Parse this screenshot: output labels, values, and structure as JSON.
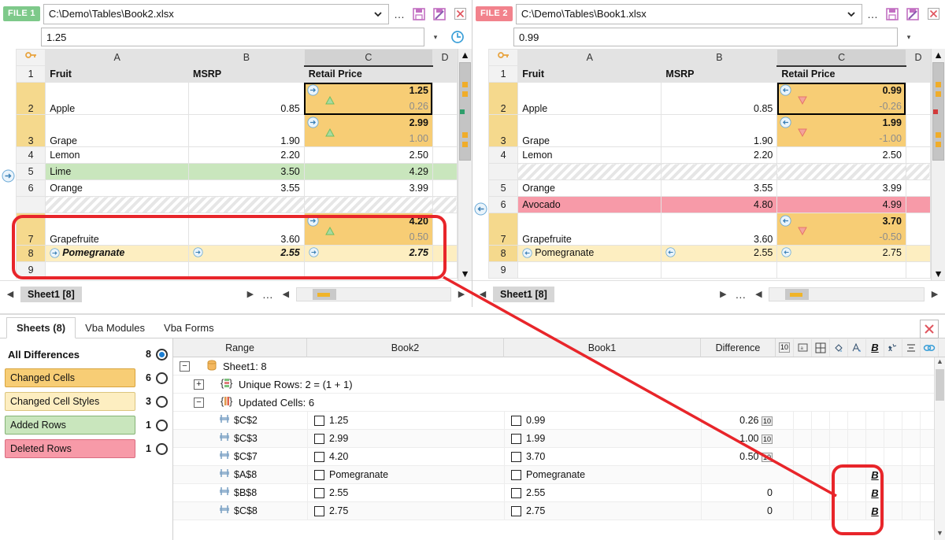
{
  "file1": {
    "badge": "FILE 1",
    "path": "C:\\Demo\\Tables\\Book2.xlsx",
    "formula": "1.25",
    "sheet_tab": "Sheet1 [8]",
    "columns": [
      "A",
      "B",
      "C",
      "D"
    ],
    "header_row": [
      "Fruit",
      "MSRP",
      "Retail Price"
    ],
    "rows": [
      {
        "n": "1",
        "a": "Fruit",
        "b": "MSRP",
        "c": "Retail Price",
        "kind": "header"
      },
      {
        "n": "2",
        "a": "Apple",
        "b": "0.85",
        "c_new": "1.25",
        "c_old": "0.26",
        "kind": "changed",
        "framed": true,
        "dir": "right",
        "trend": "up"
      },
      {
        "n": "3",
        "a": "Grape",
        "b": "1.90",
        "c_new": "2.99",
        "c_old": "1.00",
        "kind": "changed",
        "dir": "right",
        "trend": "up"
      },
      {
        "n": "4",
        "a": "Lemon",
        "b": "2.20",
        "c": "2.50",
        "kind": "normal"
      },
      {
        "n": "5",
        "a": "Lime",
        "b": "3.50",
        "c": "4.29",
        "kind": "added",
        "dir": "right"
      },
      {
        "n": "6",
        "a": "Orange",
        "b": "3.55",
        "c": "3.99",
        "kind": "normal"
      },
      {
        "n": "",
        "a": "",
        "b": "",
        "c": "",
        "kind": "hatch"
      },
      {
        "n": "7",
        "a": "Grapefruite",
        "b": "3.60",
        "c_new": "4.20",
        "c_old": "0.50",
        "kind": "changed",
        "dir": "right",
        "trend": "up"
      },
      {
        "n": "8",
        "a": "Pomegranate",
        "b": "2.55",
        "c": "2.75",
        "kind": "style",
        "dir": "right"
      },
      {
        "n": "9",
        "a": "",
        "b": "",
        "c": "",
        "kind": "normal"
      }
    ]
  },
  "file2": {
    "badge": "FILE 2",
    "path": "C:\\Demo\\Tables\\Book1.xlsx",
    "formula": "0.99",
    "sheet_tab": "Sheet1 [8]",
    "columns": [
      "A",
      "B",
      "C",
      "D"
    ],
    "header_row": [
      "Fruit",
      "MSRP",
      "Retail Price"
    ],
    "rows": [
      {
        "n": "1",
        "a": "Fruit",
        "b": "MSRP",
        "c": "Retail Price",
        "kind": "header"
      },
      {
        "n": "2",
        "a": "Apple",
        "b": "0.85",
        "c_new": "0.99",
        "c_old": "-0.26",
        "kind": "changed",
        "framed": true,
        "dir": "left",
        "trend": "down"
      },
      {
        "n": "3",
        "a": "Grape",
        "b": "1.90",
        "c_new": "1.99",
        "c_old": "-1.00",
        "kind": "changed",
        "dir": "left",
        "trend": "down"
      },
      {
        "n": "4",
        "a": "Lemon",
        "b": "2.20",
        "c": "2.50",
        "kind": "normal"
      },
      {
        "n": "",
        "a": "",
        "b": "",
        "c": "",
        "kind": "hatch"
      },
      {
        "n": "5",
        "a": "Orange",
        "b": "3.55",
        "c": "3.99",
        "kind": "normal"
      },
      {
        "n": "6",
        "a": "Avocado",
        "b": "4.80",
        "c": "4.99",
        "kind": "deleted",
        "dir": "left"
      },
      {
        "n": "7",
        "a": "Grapefruite",
        "b": "3.60",
        "c_new": "3.70",
        "c_old": "-0.50",
        "kind": "changed",
        "dir": "left",
        "trend": "down"
      },
      {
        "n": "8",
        "a": "Pomegranate",
        "b": "2.55",
        "c": "2.75",
        "kind": "style",
        "dir": "left"
      },
      {
        "n": "9",
        "a": "",
        "b": "",
        "c": "",
        "kind": "normal"
      }
    ]
  },
  "header_icons": {
    "more": "…",
    "save": "save-icon",
    "save_as": "save-as-icon",
    "close": "close-icon",
    "refresh": "refresh-icon",
    "dropdown": "chevron-down-icon"
  },
  "bottom": {
    "tabs": [
      {
        "label": "Sheets (8)",
        "active": true
      },
      {
        "label": "Vba Modules",
        "active": false
      },
      {
        "label": "Vba Forms",
        "active": false
      }
    ],
    "close_label": "✕",
    "filters": [
      {
        "label": "All Differences",
        "count": "8",
        "selected": true,
        "color": "#ffffff"
      },
      {
        "label": "Changed Cells",
        "count": "6",
        "selected": false,
        "color": "#f7cd75"
      },
      {
        "label": "Changed Cell Styles",
        "count": "3",
        "selected": false,
        "color": "#fdeec1"
      },
      {
        "label": "Added Rows",
        "count": "1",
        "selected": false,
        "color": "#c9e6bd"
      },
      {
        "label": "Deleted Rows",
        "count": "1",
        "selected": false,
        "color": "#f79aa8"
      }
    ],
    "columns": {
      "range": "Range",
      "book2": "Book2",
      "book1": "Book1",
      "difference": "Difference"
    },
    "toolbar": [
      {
        "name": "number-format-icon",
        "glyph": "10"
      },
      {
        "name": "text-format-icon",
        "glyph": "▭"
      },
      {
        "name": "borders-icon",
        "glyph": "⊞"
      },
      {
        "name": "fill-color-icon",
        "glyph": "△"
      },
      {
        "name": "font-color-icon",
        "glyph": "A"
      },
      {
        "name": "bold-icon",
        "glyph": "B"
      },
      {
        "name": "effects-icon",
        "glyph": "⚙"
      },
      {
        "name": "alignment-icon",
        "glyph": "≡"
      },
      {
        "name": "link-icon",
        "glyph": "∞"
      }
    ],
    "tree": [
      {
        "type": "node",
        "level": 0,
        "expander": "−",
        "icon": "sheet-icon",
        "label": "Sheet1: 8"
      },
      {
        "type": "node",
        "level": 1,
        "expander": "+",
        "icon": "unique-rows-icon",
        "label": "Unique Rows: 2 = (1 + 1)"
      },
      {
        "type": "node",
        "level": 1,
        "expander": "−",
        "icon": "updated-cells-icon",
        "label": "Updated Cells: 6"
      },
      {
        "type": "row",
        "range": "$C$2",
        "book2": "1.25",
        "book1": "0.99",
        "difference": "0.26",
        "diff_badge": "10",
        "bold": ""
      },
      {
        "type": "row",
        "range": "$C$3",
        "book2": "2.99",
        "book1": "1.99",
        "difference": "1.00",
        "diff_badge": "10",
        "bold": ""
      },
      {
        "type": "row",
        "range": "$C$7",
        "book2": "4.20",
        "book1": "3.70",
        "difference": "0.50",
        "diff_badge": "10",
        "bold": ""
      },
      {
        "type": "row",
        "range": "$A$8",
        "book2": "Pomegranate",
        "book1": "Pomegranate",
        "difference": "",
        "diff_badge": "",
        "bold": "B"
      },
      {
        "type": "row",
        "range": "$B$8",
        "book2": "2.55",
        "book1": "2.55",
        "difference": "0",
        "diff_badge": "",
        "bold": "B"
      },
      {
        "type": "row",
        "range": "$C$8",
        "book2": "2.75",
        "book1": "2.75",
        "difference": "0",
        "diff_badge": "",
        "bold": "B"
      }
    ]
  },
  "colors": {
    "changed_cell": "#f7cd75",
    "changed_style": "#fdeec1",
    "added_row": "#c9e6bd",
    "deleted_row": "#f79aa8",
    "annotation": "#e8252a",
    "file1_badge": "#7ec98a",
    "file2_badge": "#f2828c"
  }
}
